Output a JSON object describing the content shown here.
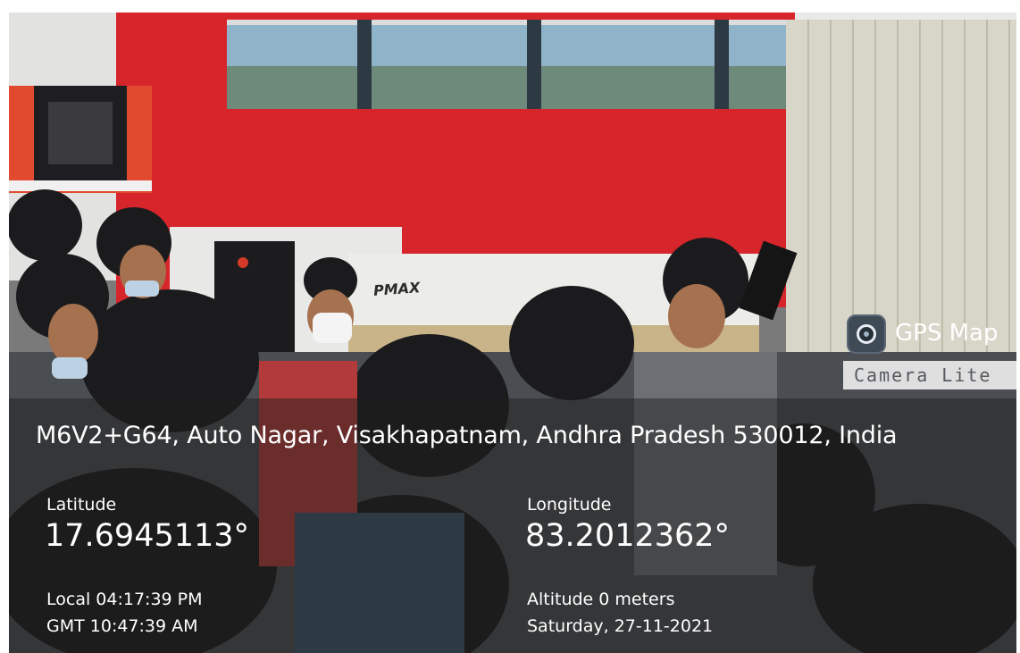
{
  "overlay": {
    "address": "M6V2+G64, Auto Nagar, Visakhapatnam, Andhra Pradesh 530012, India",
    "latitude_label": "Latitude",
    "latitude_value": "17.6945113°",
    "longitude_label": "Longitude",
    "longitude_value": "83.2012362°",
    "local_time": "Local 04:17:39 PM",
    "gmt_time": "GMT 10:47:39 AM",
    "altitude": "Altitude 0 meters",
    "date": "Saturday, 27-11-2021"
  },
  "watermark": {
    "title": "GPS Map",
    "subtitle": "Camera Lite",
    "icon": "camera-lens-icon"
  },
  "scene": {
    "machine_brand": "PMAX"
  },
  "colors": {
    "red_wall": "#d6262c",
    "overlay_background": "#1e1e1e",
    "overlay_text": "#ffffff"
  }
}
